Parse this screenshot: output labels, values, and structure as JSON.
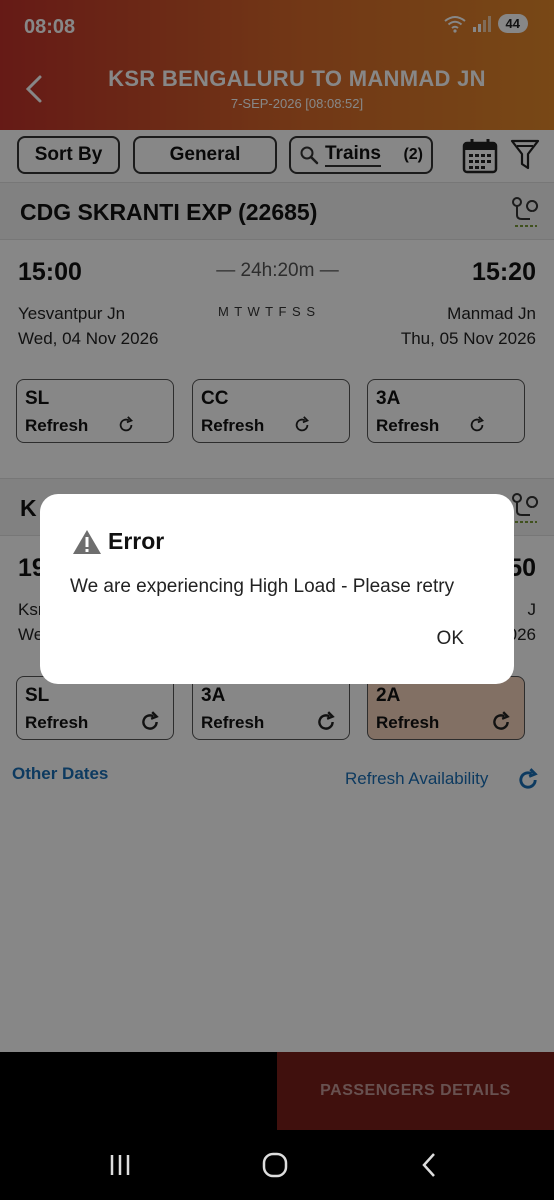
{
  "status_bar": {
    "time": "08:08",
    "battery": "44"
  },
  "header": {
    "title": "KSR BENGALURU TO MANMAD JN",
    "subtitle": "7-SEP-2026 [08:08:52]"
  },
  "filters": {
    "sort_label": "Sort By",
    "quota_label": "General",
    "trains_label": "Trains",
    "trains_count": "(2)"
  },
  "trains": [
    {
      "name": "CDG SKRANTI EXP (22685)",
      "depart_time": "15:00",
      "arrive_time": "15:20",
      "duration": "24h:20m",
      "from_station": "Yesvantpur Jn",
      "to_station": "Manmad Jn",
      "depart_date": "Wed, 04 Nov 2026",
      "arrive_date": "Thu, 05 Nov 2026",
      "days_text": "M T W T F S S",
      "classes": [
        {
          "code": "SL",
          "status": "Refresh"
        },
        {
          "code": "CC",
          "status": "Refresh"
        },
        {
          "code": "3A",
          "status": "Refresh"
        }
      ]
    },
    {
      "name_partial": "K",
      "depart_partial": "19",
      "arrive_partial": "50",
      "from_partial": "Ksr",
      "from_date_partial": "We",
      "to_partial": "J",
      "to_date_partial": "026",
      "classes": [
        {
          "code": "SL",
          "status": "Refresh"
        },
        {
          "code": "3A",
          "status": "Refresh"
        },
        {
          "code": "2A",
          "status": "Refresh"
        }
      ],
      "other_dates": "Other Dates",
      "refresh_availability": "Refresh Availability"
    }
  ],
  "bottom": {
    "passengers_button": "PASSENGERS DETAILS"
  },
  "dialog": {
    "title": "Error",
    "message": "We are experiencing High Load - Please retry",
    "ok": "OK"
  },
  "colors": {
    "header_start": "#c0322a",
    "header_end": "#e2882a",
    "link": "#1a6fb5",
    "button_bg": "#c0322a"
  }
}
